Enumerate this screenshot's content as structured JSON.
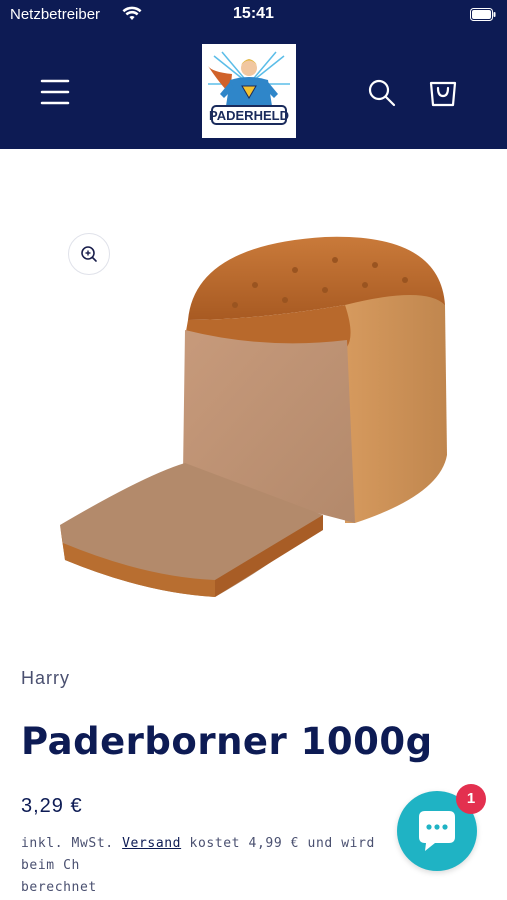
{
  "status_bar": {
    "carrier": "Netzbetreiber",
    "time": "15:41",
    "wifi_icon": "wifi-icon",
    "battery_icon": "battery-icon"
  },
  "header": {
    "menu_icon": "hamburger-menu-icon",
    "logo_text": "PADERHELD",
    "search_icon": "search-icon",
    "cart_icon": "shopping-bag-icon",
    "background_color": "#0d1b54"
  },
  "product": {
    "zoom_icon": "zoom-in-icon",
    "image": "bread-loaf-image",
    "vendor": "Harry",
    "title": "Paderborner 1000g",
    "price": "3,29 €",
    "tax_prefix": "inkl. MwSt. ",
    "shipping_link": "Versand",
    "tax_suffix": " kostet 4,99 € und wird beim Ch",
    "tax_line2": "berechnet"
  },
  "chat": {
    "icon": "chat-bubble-icon",
    "badge_count": "1",
    "color": "#1fb3c4",
    "badge_color": "#e3304f"
  }
}
